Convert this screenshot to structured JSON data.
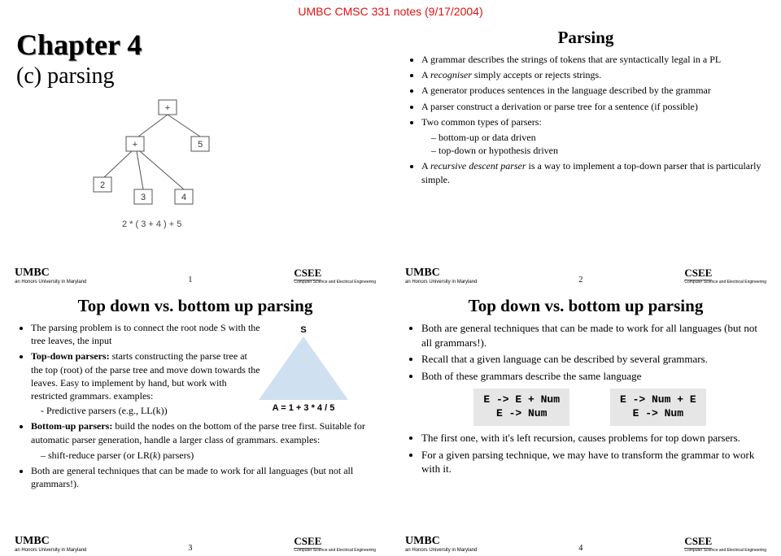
{
  "header": "UMBC CMSC 331 notes (9/17/2004)",
  "slide1": {
    "title": "Chapter 4",
    "subtitle": "(c) parsing",
    "tree_caption": "2 * ( 3 + 4 ) + 5",
    "nodes": {
      "n1": "+",
      "n2": "+",
      "n3": "5",
      "n4": "2",
      "n5": "3",
      "n6": "4"
    },
    "page": "1"
  },
  "slide2": {
    "title": "Parsing",
    "b1": "A grammar describes the strings of tokens that are syntactically legal in a PL",
    "b2_pre": "A ",
    "b2_i": "recogniser",
    "b2_post": " simply accepts or rejects strings.",
    "b3": "A generator produces sentences in the language described by the grammar",
    "b4": "A parser construct a derivation or parse tree for a sentence (if possible)",
    "b5": "Two common types of parsers:",
    "b5a": "bottom-up or data driven",
    "b5b": "top-down or hypothesis driven",
    "b6_pre": "A ",
    "b6_i": "recursive descent parser",
    "b6_post": " is a way to implement a top-down parser that is particularly simple.",
    "page": "2"
  },
  "slide3": {
    "title": "Top down vs. bottom up parsing",
    "tri_top": "S",
    "tri_bot": "A = 1 + 3 * 4 / 5",
    "b1": "The parsing problem is to connect the root node S with the tree leaves, the input",
    "b2_pre": "Top-down parsers:",
    "b2_post": " starts constructing the parse tree at the top (root) of the parse tree and move down towards the leaves. Easy to implement by hand, but work with restricted grammars. examples:",
    "b2a": "Predictive parsers (e.g., LL(k))",
    "b3_pre": "Bottom-up parsers:",
    "b3_post": " build the nodes on the bottom of the parse tree first. Suitable for automatic parser generation, handle a larger class of grammars. examples:",
    "b3a_pre": "shift-reduce parser (or LR(",
    "b3a_i": "k",
    "b3a_post": ") parsers)",
    "b4": "Both are general techniques that can be made to work for all languages (but not all grammars!).",
    "page": "3"
  },
  "slide4": {
    "title": "Top down vs. bottom up parsing",
    "b1": "Both are general techniques that can be made to work for all languages (but not all grammars!).",
    "b2": "Recall that a given language can be described by several grammars.",
    "b3": "Both of these grammars describe the same language",
    "g1a": "E -> E + Num",
    "g1b": "E -> Num",
    "g2a": "E -> Num + E",
    "g2b": "E -> Num",
    "b4": "The first one, with it's left recursion, causes problems for top down parsers.",
    "b5": "For a given parsing technique, we may have to transform the grammar to work with it.",
    "page": "4"
  },
  "logo": {
    "umbc": "UMBC",
    "umbc_sub": "an Honors University in Maryland",
    "csee": "CSEE",
    "csee_sub": "Computer Science and\nElectrical Engineering"
  }
}
